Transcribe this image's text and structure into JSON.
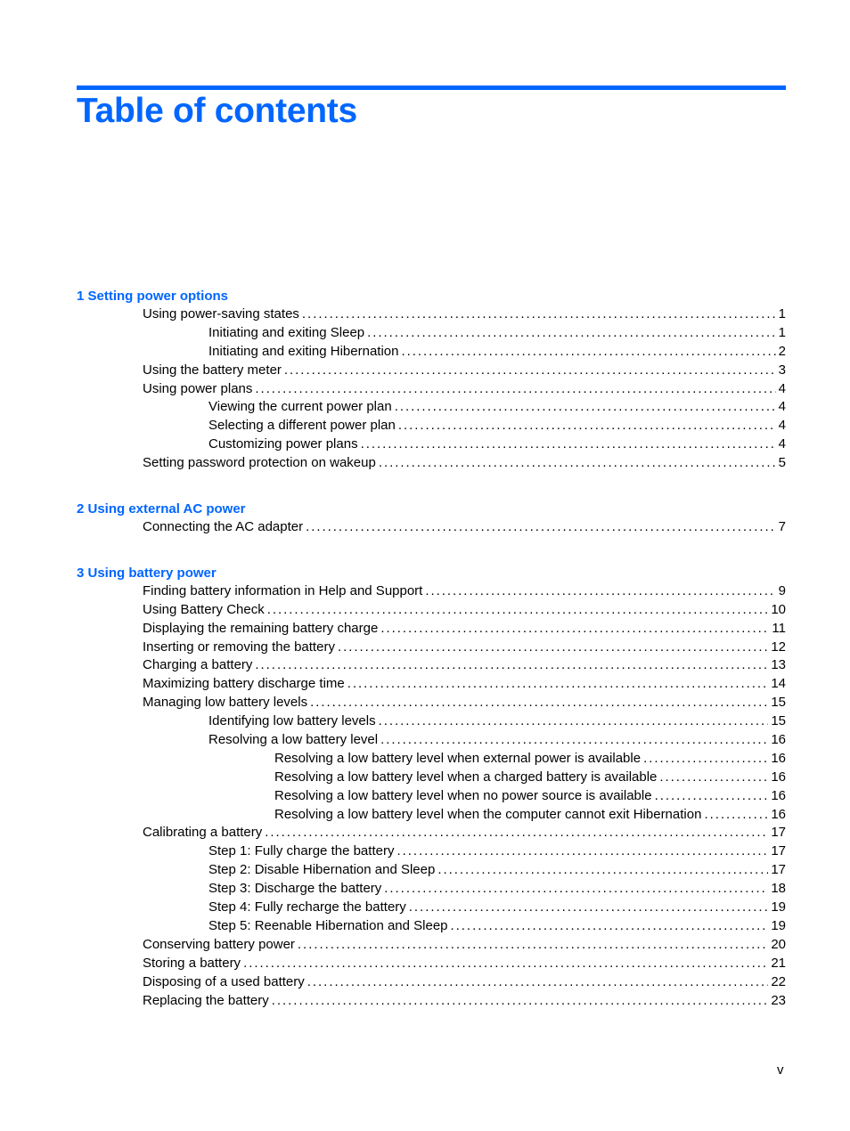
{
  "header": {
    "title": "Table of contents"
  },
  "chapters": [
    {
      "title": "1  Setting power options",
      "entries": [
        {
          "level": 1,
          "label": "Using power-saving states",
          "page": "1"
        },
        {
          "level": 2,
          "label": "Initiating and exiting Sleep",
          "page": "1"
        },
        {
          "level": 2,
          "label": "Initiating and exiting Hibernation",
          "page": "2"
        },
        {
          "level": 1,
          "label": "Using the battery meter",
          "page": "3"
        },
        {
          "level": 1,
          "label": "Using power plans",
          "page": "4"
        },
        {
          "level": 2,
          "label": "Viewing the current power plan",
          "page": "4"
        },
        {
          "level": 2,
          "label": "Selecting a different power plan",
          "page": "4"
        },
        {
          "level": 2,
          "label": "Customizing power plans",
          "page": "4"
        },
        {
          "level": 1,
          "label": "Setting password protection on wakeup",
          "page": "5"
        }
      ]
    },
    {
      "title": "2  Using external AC power",
      "entries": [
        {
          "level": 1,
          "label": "Connecting the AC adapter",
          "page": "7"
        }
      ]
    },
    {
      "title": "3  Using battery power",
      "entries": [
        {
          "level": 1,
          "label": "Finding battery information in Help and Support",
          "page": "9"
        },
        {
          "level": 1,
          "label": "Using Battery Check",
          "page": "10"
        },
        {
          "level": 1,
          "label": "Displaying the remaining battery charge",
          "page": "11"
        },
        {
          "level": 1,
          "label": "Inserting or removing the battery",
          "page": "12"
        },
        {
          "level": 1,
          "label": "Charging a battery",
          "page": "13"
        },
        {
          "level": 1,
          "label": "Maximizing battery discharge time",
          "page": "14"
        },
        {
          "level": 1,
          "label": "Managing low battery levels",
          "page": "15"
        },
        {
          "level": 2,
          "label": "Identifying low battery levels",
          "page": "15"
        },
        {
          "level": 2,
          "label": "Resolving a low battery level",
          "page": "16"
        },
        {
          "level": 3,
          "label": "Resolving a low battery level when external power is available",
          "page": "16"
        },
        {
          "level": 3,
          "label": "Resolving a low battery level when a charged battery is available",
          "page": "16"
        },
        {
          "level": 3,
          "label": "Resolving a low battery level when no power source is available",
          "page": "16"
        },
        {
          "level": 3,
          "label": "Resolving a low battery level when the computer cannot exit Hibernation",
          "page": "16"
        },
        {
          "level": 1,
          "label": "Calibrating a battery",
          "page": "17"
        },
        {
          "level": 2,
          "label": "Step 1: Fully charge the battery",
          "page": "17"
        },
        {
          "level": 2,
          "label": "Step 2: Disable Hibernation and Sleep",
          "page": "17"
        },
        {
          "level": 2,
          "label": "Step 3: Discharge the battery",
          "page": "18"
        },
        {
          "level": 2,
          "label": "Step 4: Fully recharge the battery",
          "page": "19"
        },
        {
          "level": 2,
          "label": "Step 5: Reenable Hibernation and Sleep",
          "page": "19"
        },
        {
          "level": 1,
          "label": "Conserving battery power",
          "page": "20"
        },
        {
          "level": 1,
          "label": "Storing a battery",
          "page": "21"
        },
        {
          "level": 1,
          "label": "Disposing of a used battery",
          "page": "22"
        },
        {
          "level": 1,
          "label": "Replacing the battery",
          "page": "23"
        }
      ]
    }
  ],
  "footer": {
    "page_number": "v"
  },
  "colors": {
    "accent": "#0066ff",
    "text": "#000000"
  }
}
